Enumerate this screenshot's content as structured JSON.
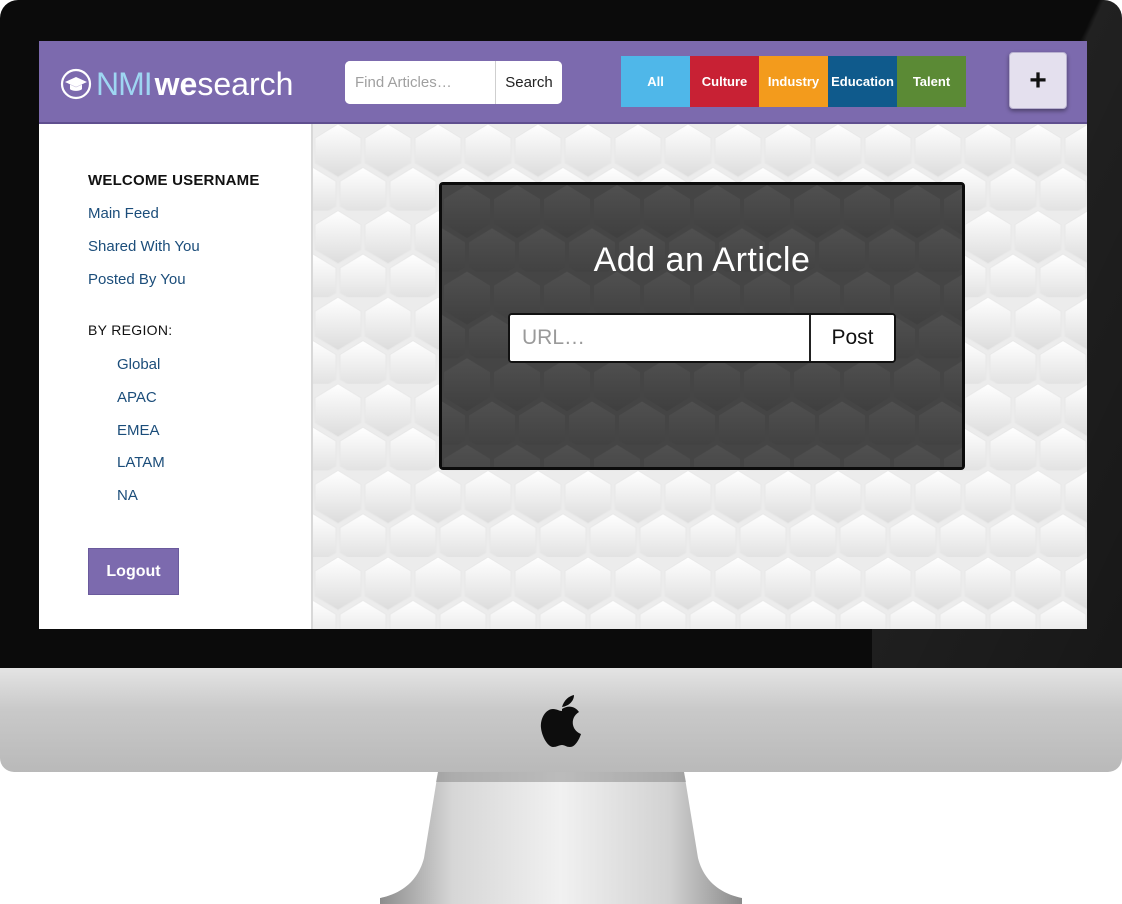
{
  "brand": {
    "part1": "NMI",
    "part2": "we",
    "part3": "search"
  },
  "search": {
    "placeholder": "Find Articles…",
    "button": "Search"
  },
  "categories": [
    {
      "label": "All",
      "color": "#4fb7e9"
    },
    {
      "label": "Culture",
      "color": "#c82134"
    },
    {
      "label": "Industry",
      "color": "#f39b1c"
    },
    {
      "label": "Education",
      "color": "#0f5a8c"
    },
    {
      "label": "Talent",
      "color": "#5b8a35"
    }
  ],
  "add_button": {
    "label": "+"
  },
  "sidebar": {
    "welcome": "WELCOME USERNAME",
    "links": [
      "Main Feed",
      "Shared With You",
      "Posted By You"
    ],
    "region_title": "BY REGION:",
    "regions": [
      "Global",
      "APAC",
      "EMEA",
      "LATAM",
      "NA"
    ],
    "logout": "Logout"
  },
  "article_card": {
    "title": "Add an Article",
    "url_placeholder": "URL…",
    "post_button": "Post"
  },
  "colors": {
    "brand": "#7c6aae",
    "link": "#1b4d7a",
    "card": "#474747"
  },
  "icons": [
    "graduation-cap-icon",
    "apple-logo-icon"
  ]
}
